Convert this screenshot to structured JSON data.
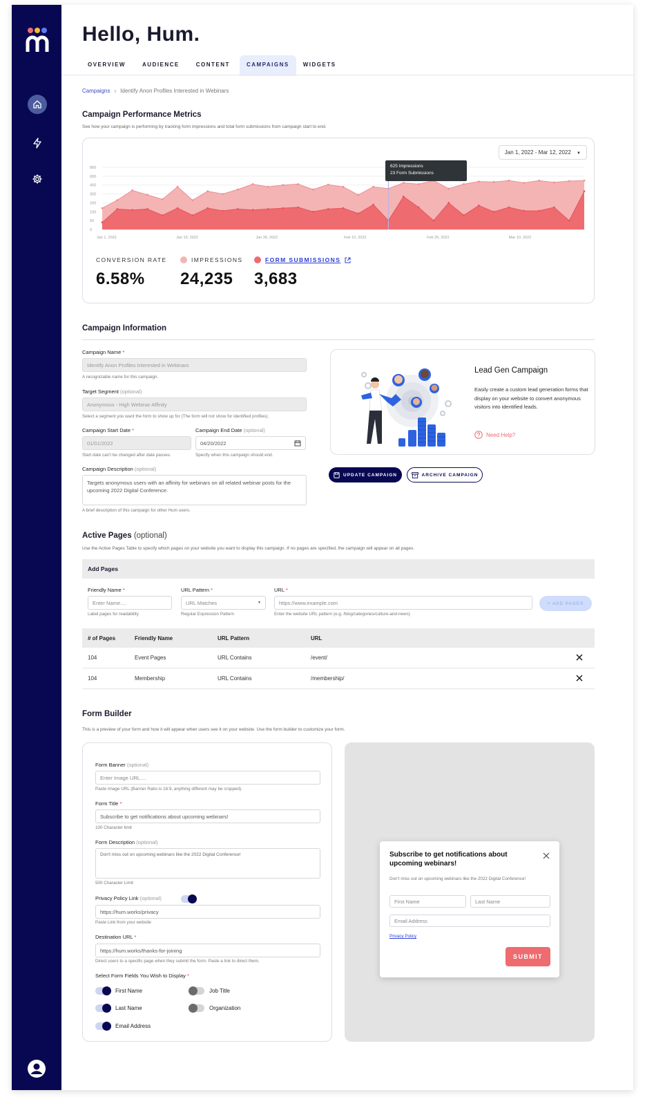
{
  "greeting": "Hello, Hum.",
  "tabs": [
    "OVERVIEW",
    "AUDIENCE",
    "CONTENT",
    "CAMPAIGNS",
    "WIDGETS"
  ],
  "active_tab": "CAMPAIGNS",
  "breadcrumb": {
    "root": "Campaigns",
    "current": "Identify Anon Profiles Interested in Webinars"
  },
  "performance": {
    "title": "Campaign Performance Metrics",
    "subtitle": "See how your campaign is performing by tracking form impressions and total form submissions from campaign start to end.",
    "date_range": "Jan 1, 2022 - Mar 12, 2022",
    "tooltip": {
      "line1": "625 Impressions",
      "line2": "23 Form Submissions"
    },
    "metrics": {
      "conversion_label": "CONVERSION RATE",
      "conversion_value": "6.58%",
      "impressions_label": "IMPRESSIONS",
      "impressions_value": "24,235",
      "submissions_label": "FORM SUBMISSIONS",
      "submissions_value": "3,683"
    },
    "colors": {
      "impressions": "#f4b4b4",
      "submissions": "#ee6b70",
      "impressions_line": "#ec8f95"
    }
  },
  "chart_data": {
    "type": "area",
    "x_ticks": [
      "Jan 1, 2022",
      "Jan 15, 2022",
      "Jan 30, 2022",
      "Feb 10, 2022",
      "Feb 25, 2022",
      "Mar 10, 2022"
    ],
    "y_ticks": [
      "0",
      "50",
      "100",
      "200",
      "300",
      "400",
      "600",
      "800"
    ],
    "ylim": [
      0,
      800
    ],
    "grid": true,
    "series": [
      {
        "name": "Impressions",
        "values": [
          140,
          230,
          340,
          290,
          240,
          380,
          230,
          330,
          300,
          350,
          420,
          380,
          400,
          420,
          350,
          410,
          380,
          290,
          380,
          360,
          450,
          420,
          500,
          360,
          420,
          480,
          470,
          500,
          450,
          500,
          460,
          490,
          500
        ]
      },
      {
        "name": "Form Submissions",
        "values": [
          40,
          130,
          120,
          130,
          80,
          140,
          80,
          140,
          110,
          130,
          120,
          130,
          140,
          150,
          100,
          130,
          140,
          90,
          180,
          50,
          270,
          150,
          50,
          200,
          80,
          170,
          100,
          150,
          110,
          110,
          150,
          50,
          330
        ]
      }
    ]
  },
  "info": {
    "title": "Campaign Information",
    "name_label": "Campaign Name",
    "name_value": "Identify Anon Profiles Interested in Webinars",
    "name_help": "A recognizable name for this campaign.",
    "segment_label": "Target Segment",
    "segment_opt": "(optional)",
    "segment_value": "Anonymous - High Webinar Affinity",
    "segment_help": "Select a segment you want the form to show up for (The form will not show for identified profiles).",
    "start_label": "Campaign Start Date",
    "start_value": "01/01/2022",
    "start_help": "Start date can't be changed after date passes.",
    "end_label": "Campaign End Date",
    "end_opt": "(optional)",
    "end_value": "04/20/2022",
    "end_help": "Specify when this campaign should end.",
    "desc_label": "Campaign Description",
    "desc_opt": "(optional)",
    "desc_value": "Targets anonymous users with an affinity for webinars on all related webinar posts for the upcoming 2022 Digital Conference.",
    "desc_help": "A brief description of this campaign for other Hum users.",
    "required_mark": "*"
  },
  "leadgen": {
    "title": "Lead Gen Campaign",
    "body": "Easily create a custom lead generation forms that display on your website to convert anonymous visitors into identified leads.",
    "help": "Need Help?"
  },
  "buttons": {
    "update": "UPDATE CAMPAIGN",
    "archive": "ARCHIVE CAMPAIGN",
    "add_pages": "+ ADD PAGES"
  },
  "active_pages": {
    "title": "Active Pages",
    "title_opt": "(optional)",
    "subtitle": "Use the Active Pages Table to specify which pages on your website you want to display this campaign. If no pages are specified, the campaign will appear on all pages.",
    "add_bar": "Add Pages",
    "friendly_label": "Friendly Name",
    "friendly_placeholder": "Enter Name....",
    "friendly_help": "Label pages for readability",
    "pattern_label": "URL Pattern",
    "pattern_value": "URL Matches",
    "pattern_help": "Regular Expression Pattern",
    "url_label": "URL",
    "url_placeholder": "https://www.example.com",
    "url_help": "Enter the website URL pattern (e.g. /blog/categories/culture-and-news)",
    "columns": [
      "# of Pages",
      "Friendly Name",
      "URL Pattern",
      "URL"
    ],
    "rows": [
      {
        "count": "104",
        "name": "Event Pages",
        "pattern": "URL Contains",
        "url": "/event/"
      },
      {
        "count": "104",
        "name": "Membership",
        "pattern": "URL Contains",
        "url": "/membership/"
      }
    ]
  },
  "form_builder": {
    "title": "Form Builder",
    "subtitle": "This is a preview of your form and how it will appear when users see it on your website. Use the form builder to customize your form.",
    "banner_label": "Form Banner",
    "banner_opt": "(optional)",
    "banner_placeholder": "Enter Image URL....",
    "banner_help": "Paste Image URL (Banner Ratio is 16:9, anything different may be cropped).",
    "title_label": "Form Title",
    "title_value": "Subscribe to get notifications about upcoming webinars!",
    "title_help": "100 Character limit",
    "desc_label": "Form Description",
    "desc_opt": "(optional)",
    "desc_value": "Don't miss out on upcoming webinars like the 2022 Digital Conference!",
    "desc_help": "500 Character Limit",
    "privacy_label": "Privacy Policy Link",
    "privacy_opt": "(optional)",
    "privacy_value": "https://hum.works/privacy",
    "privacy_help": "Paste Link from your website",
    "dest_label": "Destination URL",
    "dest_value": "https://hum.works/thanks-for-joining",
    "dest_help": "Direct users to a specific page when they submit the form. Paste a link to direct them.",
    "fields_label": "Select Form Fields You Wish to Display",
    "fields": [
      {
        "label": "First Name",
        "on": true
      },
      {
        "label": "Last Name",
        "on": true
      },
      {
        "label": "Email Address",
        "on": true
      },
      {
        "label": "Job Title",
        "on": false
      },
      {
        "label": "Organization",
        "on": false
      }
    ]
  },
  "preview": {
    "title": "Subscribe to get notifications about upcoming webinars!",
    "desc": "Don't miss out on upcoming webinars like the 2022 Digital Conference!",
    "first_placeholder": "First Name",
    "last_placeholder": "Last Name",
    "email_placeholder": "Email Address",
    "privacy_link": "Privacy Policy",
    "submit": "SUBMIT",
    "submit_color": "#ee6b70"
  }
}
